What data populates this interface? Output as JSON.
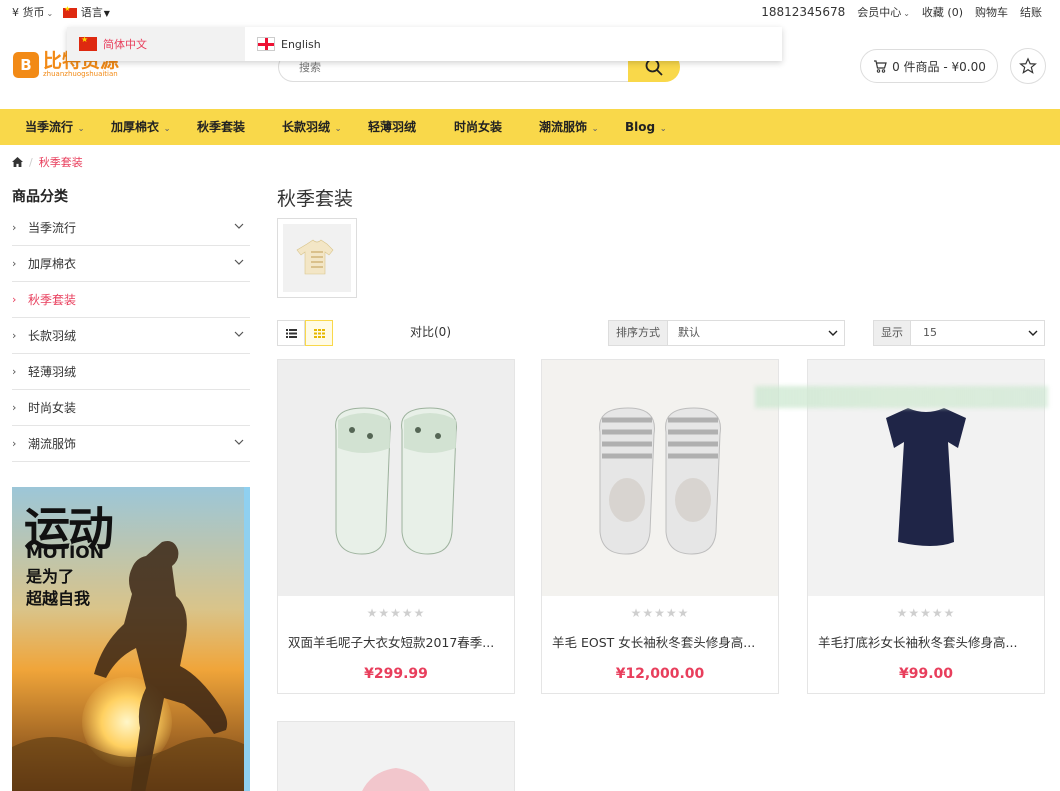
{
  "topbar": {
    "currency": "¥ 货币",
    "language": "语言",
    "phone": "18812345678",
    "member": "会员中心",
    "favorites": "收藏 (0)",
    "cart": "购物车",
    "checkout": "结账"
  },
  "language_menu": {
    "options": [
      "简体中文",
      "English"
    ],
    "selected": "简体中文"
  },
  "header": {
    "logo_text": "比特资源",
    "logo_sub": "zhuanzhuogshuaitian",
    "search_placeholder": "搜索",
    "cart_summary": "0 件商品 - ¥0.00"
  },
  "nav": {
    "items": [
      {
        "label": "当季流行",
        "dropdown": true
      },
      {
        "label": "加厚棉衣",
        "dropdown": true
      },
      {
        "label": "秋季套装",
        "dropdown": false
      },
      {
        "label": "长款羽绒",
        "dropdown": true
      },
      {
        "label": "轻薄羽绒",
        "dropdown": false
      },
      {
        "label": "时尚女装",
        "dropdown": false
      },
      {
        "label": "潮流服饰",
        "dropdown": true
      },
      {
        "label": "Blog",
        "dropdown": true
      }
    ]
  },
  "breadcrumb": {
    "current": "秋季套装"
  },
  "sidebar": {
    "title": "商品分类",
    "categories": [
      {
        "label": "当季流行",
        "expandable": true
      },
      {
        "label": "加厚棉衣",
        "expandable": true
      },
      {
        "label": "秋季套装",
        "expandable": false,
        "active": true
      },
      {
        "label": "长款羽绒",
        "expandable": true
      },
      {
        "label": "轻薄羽绒",
        "expandable": false
      },
      {
        "label": "时尚女装",
        "expandable": false
      },
      {
        "label": "潮流服饰",
        "expandable": true
      }
    ],
    "banner": {
      "line1": "运动",
      "line2": "MOTION",
      "line3": "是为了",
      "line4": "超越自我"
    }
  },
  "main": {
    "title": "秋季套装",
    "compare": "对比(0)",
    "sort_label": "排序方式",
    "sort_value": "默认",
    "show_label": "显示",
    "show_value": "15",
    "products": [
      {
        "name": "双面羊毛呢子大衣女短款2017春季...",
        "price": "¥299.99",
        "rating": 0
      },
      {
        "name": "羊毛 EOST 女长袖秋冬套头修身高...",
        "price": "¥12,000.00",
        "rating": 0
      },
      {
        "name": "羊毛打底衫女长袖秋冬套头修身高...",
        "price": "¥99.00",
        "rating": 0
      }
    ]
  },
  "colors": {
    "accent_yellow": "#f9d84a",
    "price_red": "#e83e5c",
    "logo_orange": "#f28a16"
  }
}
